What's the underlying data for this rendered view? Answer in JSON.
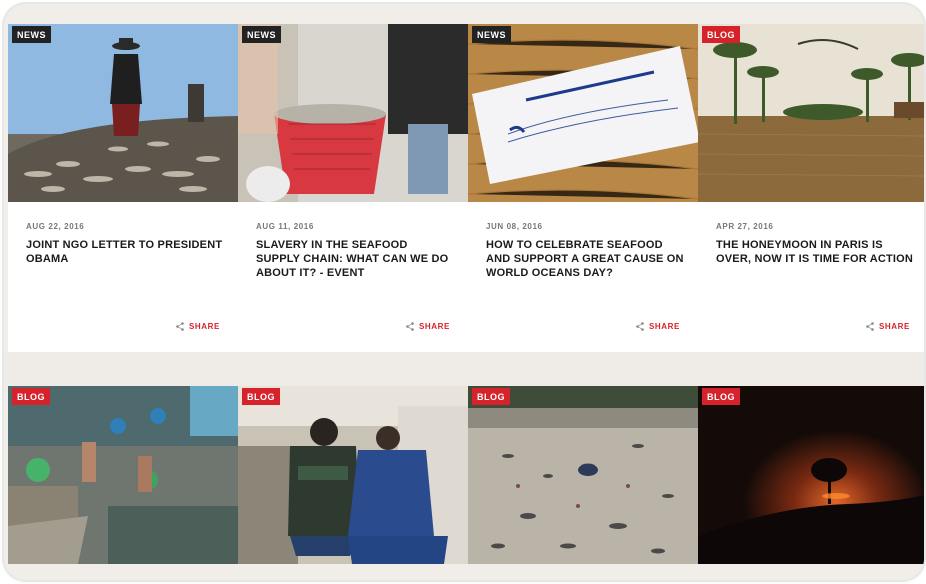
{
  "cards": [
    {
      "tag": "NEWS",
      "date": "AUG 22, 2016",
      "title": "JOINT NGO LETTER TO PRESIDENT OBAMA",
      "share": "SHARE",
      "image": "fisherman-drying-fish"
    },
    {
      "tag": "NEWS",
      "date": "AUG 11, 2016",
      "title": "SLAVERY IN THE SEAFOOD SUPPLY CHAIN: WHAT CAN WE DO ABOUT IT? - EVENT",
      "share": "SHARE",
      "image": "basket-of-fish"
    },
    {
      "tag": "NEWS",
      "date": "JUN 08, 2016",
      "title": "HOW TO CELEBRATE SEAFOOD AND SUPPORT A GREAT CAUSE ON WORLD OCEANS DAY?",
      "share": "SHARE",
      "image": "2016-invitation-card"
    },
    {
      "tag": "BLOG",
      "date": "APR 27, 2016",
      "title": "THE HONEYMOON IN PARIS IS OVER, NOW IT IS TIME FOR ACTION",
      "share": "SHARE",
      "image": "flooded-palm-grove"
    }
  ],
  "cards_row2": [
    {
      "tag": "BLOG",
      "image": "workers-on-fishing-boat"
    },
    {
      "tag": "BLOG",
      "image": "officers-guardia-civil-europol"
    },
    {
      "tag": "BLOG",
      "image": "polluted-beach"
    },
    {
      "tag": "BLOG",
      "image": "forest-fire-at-night"
    }
  ],
  "colors": {
    "accent": "#d6232b",
    "tag_dark": "#222222",
    "page_bg": "#efebe6"
  }
}
